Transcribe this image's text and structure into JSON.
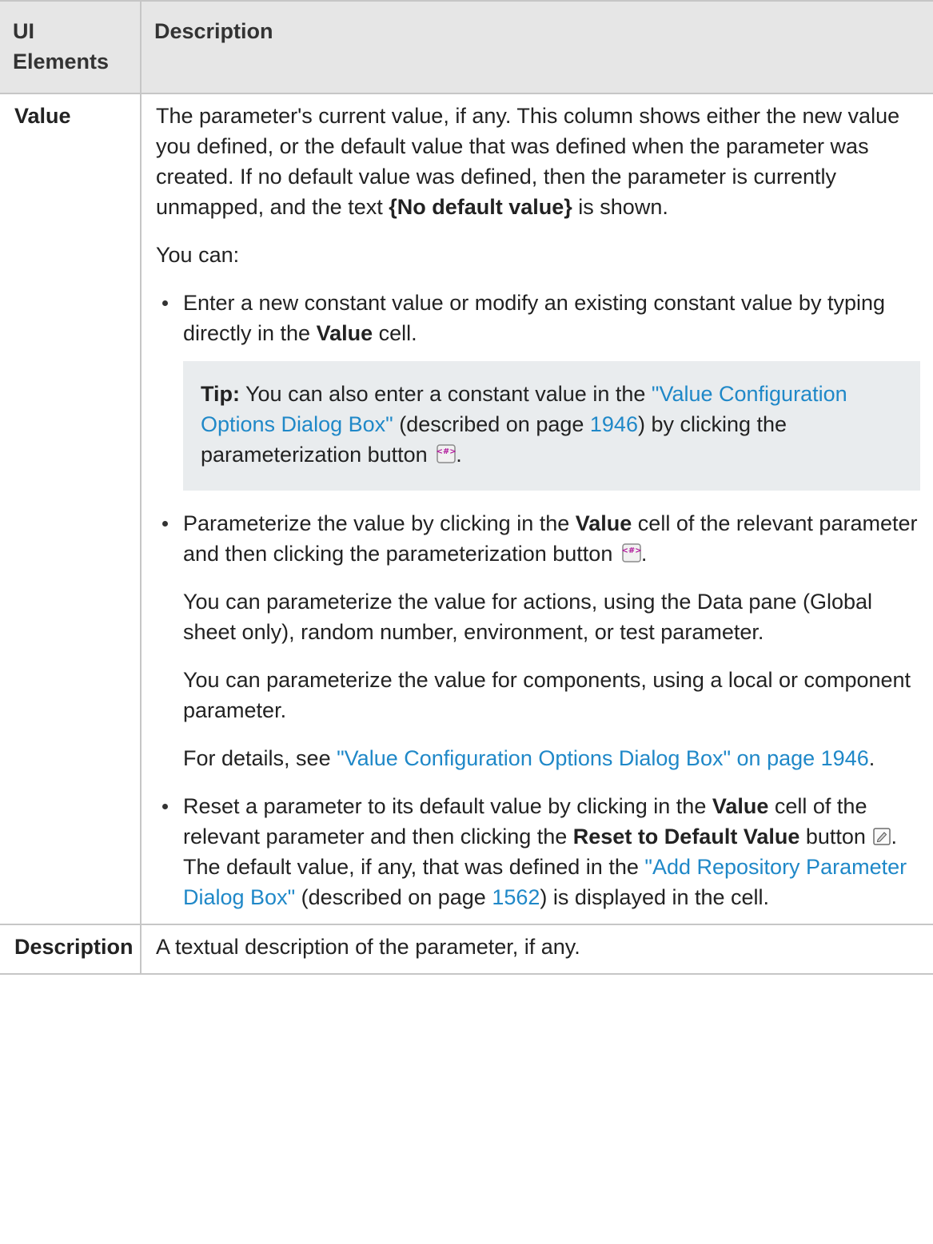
{
  "header": {
    "col1": "UI Elements",
    "col2": "Description"
  },
  "rows": [
    {
      "element": "Value",
      "intro": {
        "t1": "The parameter's current value, if any. This column shows either the new value you defined, or the default value that was defined when the parameter was created. If no default value was defined, then the parameter is currently unmapped, and the text ",
        "b1": "{No default value}",
        "t2": " is shown."
      },
      "you_can": "You can:",
      "bullet1": {
        "t1": "Enter a new constant value or modify an existing constant value by typing directly in the ",
        "b1": "Value",
        "t2": " cell."
      },
      "tip": {
        "label": "Tip:",
        "t1": " You can also enter a constant value in the ",
        "link1": "\"Value Configuration Options Dialog Box\"",
        "t2": " (described on page ",
        "link2": "1946",
        "t3": ") by clicking the parameterization button ",
        "t4": "."
      },
      "bullet2": {
        "t1": "Parameterize the value by clicking in the ",
        "b1": "Value",
        "t2": " cell of the relevant parameter and then clicking the parameterization button ",
        "t3": ".",
        "p1": "You can parameterize the value for actions, using the Data pane (Global sheet only), random number, environment, or test parameter.",
        "p2": "You can parameterize the value for components, using a local or component parameter.",
        "p3_t1": "For details, see ",
        "p3_link": "\"Value Configuration Options Dialog Box\" on page 1946",
        "p3_t2": "."
      },
      "bullet3": {
        "t1": "Reset a parameter to its default value by clicking in the ",
        "b1": "Value",
        "t2": " cell of the relevant parameter and then clicking the ",
        "b2": "Reset to Default Value",
        "t3": " button ",
        "t4": ". The default value, if any, that was defined in the ",
        "link1": "\"Add Repository Parameter Dialog Box\"",
        "t5": " (described on page ",
        "link2": "1562",
        "t6": ") is displayed in the cell."
      }
    },
    {
      "element": "Description",
      "text": "A textual description of the parameter, if any."
    }
  ],
  "colors": {
    "link": "#1f88c8",
    "header_bg": "#e6e6e6",
    "tip_bg": "#e9ecee",
    "border": "#c6c6c6"
  },
  "icons": [
    "parameterization-icon",
    "reset-to-default-icon"
  ]
}
